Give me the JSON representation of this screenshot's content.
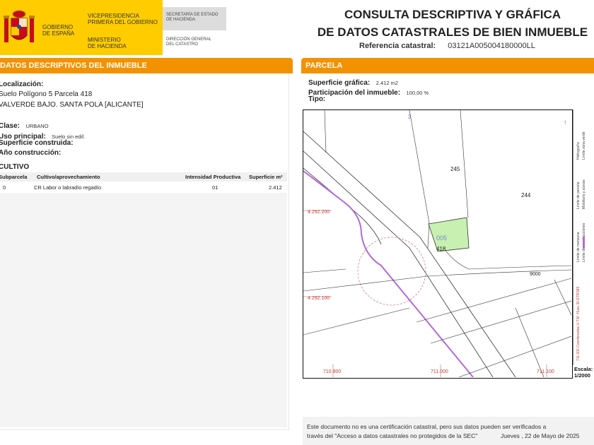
{
  "header": {
    "gov_lines": [
      "GOBIERNO",
      "DE ESPAÑA"
    ],
    "vice_lines": [
      "VICEPRESIDENCIA",
      "PRIMERA DEL GOBIERNO"
    ],
    "min_lines": [
      "MINISTERIO",
      "DE HACIENDA"
    ],
    "sec_lines": [
      "SECRETARÍA DE ESTADO",
      "DE HACIENDA"
    ],
    "dir_lines": [
      "DIRECCIÓN GENERAL",
      "DEL CATASTRO"
    ],
    "title_line1": "CONSULTA DESCRIPTIVA Y GRÁFICA",
    "title_line2": "DE DATOS CATASTRALES DE BIEN INMUEBLE",
    "ref_label": "Referencia catastral:",
    "ref_value": "03121A005004180000LL"
  },
  "left": {
    "bar": "DATOS DESCRIPTIVOS DEL INMUEBLE",
    "loc_label": "Localización:",
    "loc_line1": "Suelo Polígono 5 Parcela 418",
    "loc_line2": "VALVERDE BAJO. SANTA POLA [ALICANTE]",
    "clase_label": "Clase:",
    "clase_value": "URBANO",
    "uso_label": "Uso principal:",
    "uso_value": "Suelo sin edif.",
    "sup_label": "Superficie construida:",
    "anio_label": "Año construcción:",
    "cultivo_label": "CULTIVO",
    "table": {
      "headers": [
        "Subparcela",
        "Cultivo/aprovechamiento",
        "Intensidad Productiva",
        "Superficie m²"
      ],
      "rows": [
        [
          "0",
          "CR Labor o labradío regadío",
          "01",
          "2.412"
        ]
      ]
    }
  },
  "right": {
    "bar": "PARCELA",
    "sup_label": "Superficie gráfica:",
    "sup_value": "2.412 m2",
    "part_label": "Participación del inmueble:",
    "part_value": "100,00 %",
    "tipo_label": "Tipo:"
  },
  "map": {
    "parcel_labels": [
      "245",
      "244",
      "005",
      "418",
      "9000",
      "3"
    ],
    "coord_labels": [
      "4.292.200",
      "4.292.100",
      "710.900",
      "711.000",
      "711.100"
    ],
    "legend_items": [
      "Límite de manzana",
      "Límite de parcela",
      "Límite de construcciones",
      "Mobiliario y aceras",
      "Límite zona verde",
      "Hidrografía"
    ],
    "legend_crs": "711.000 Coordenadas U.T.M. Huso 30 ETRS89",
    "scale_label": "Escala:",
    "scale_value": "1/2000"
  },
  "footer": {
    "notice_line1": "Este documento no es una certificación catastral, pero sus datos pueden ser verificados a",
    "notice_line2": "través del \"Acceso a datos catastrales no protegidos de la SEC\"",
    "date": "Jueves , 22 de Mayo de 2025"
  },
  "colors": {
    "accent": "#f39200",
    "brand_yellow": "#ffcc00",
    "parcel_fill": "#c8f0b0",
    "road_purple": "#b469d9"
  }
}
